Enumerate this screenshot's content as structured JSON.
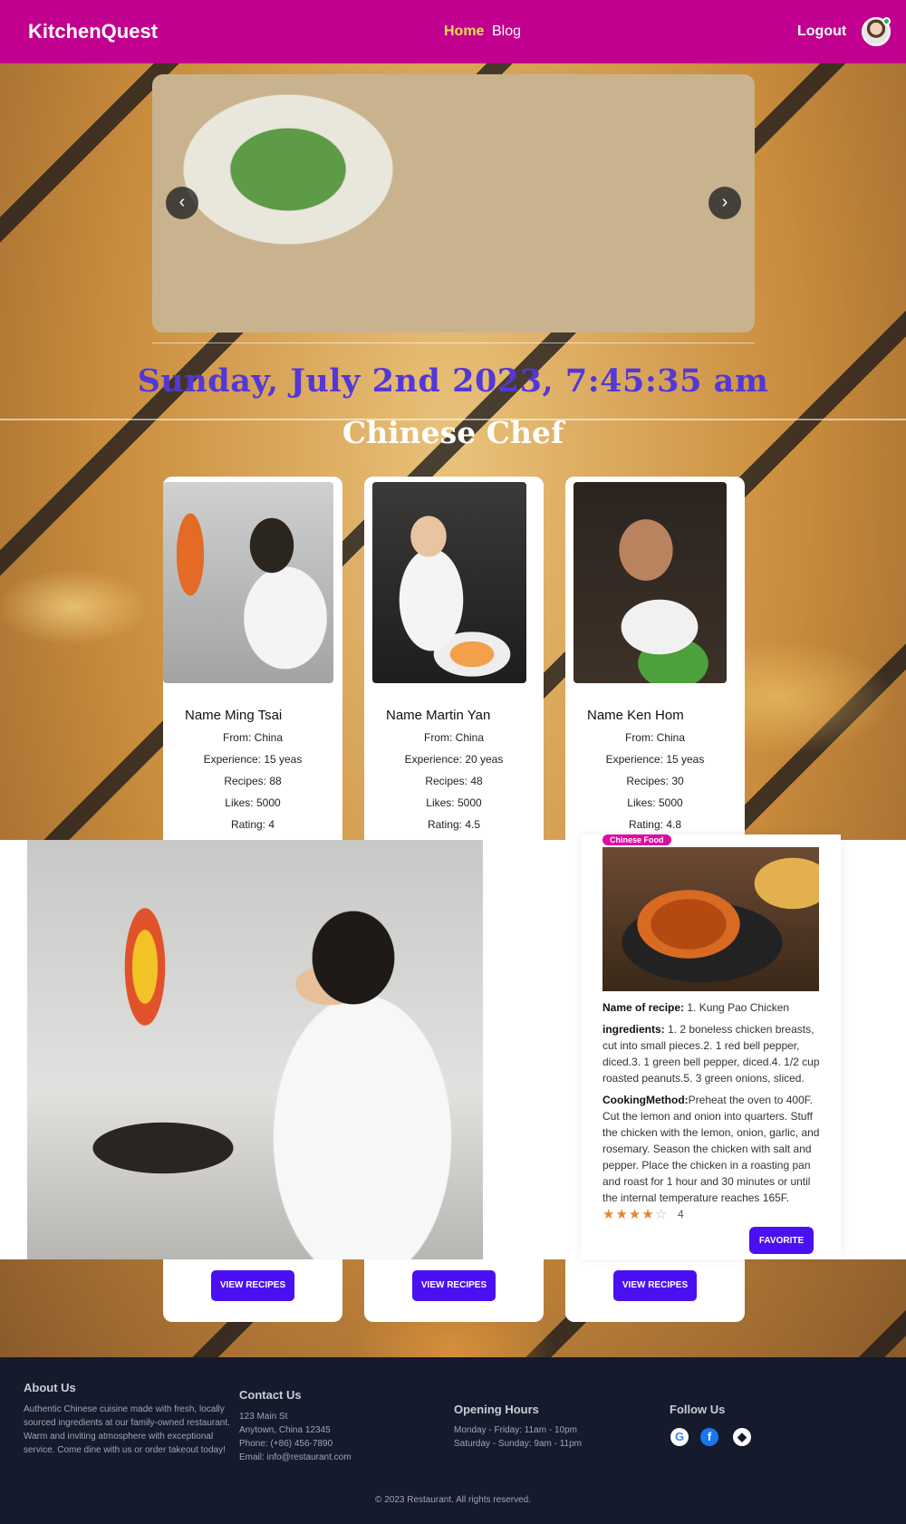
{
  "nav": {
    "brand": "KitchenQuest",
    "links": [
      "Home",
      "Blog"
    ],
    "logout": "Logout"
  },
  "carousel": {
    "prev_icon": "‹",
    "next_icon": "›"
  },
  "clock": "Sunday, July 2nd 2023, 7:45:35 am",
  "section_title": "Chinese Chef",
  "chefs": [
    {
      "name": "Name Ming Tsai",
      "from": "From: China",
      "experience": "Experience: 15 yeas",
      "recipes": "Recipes: 88",
      "likes": "Likes: 5000",
      "rating": "Rating: 4",
      "button": "VIEW RECIPES"
    },
    {
      "name": "Name Martin Yan",
      "from": "From: China",
      "experience": "Experience: 20 yeas",
      "recipes": "Recipes: 48",
      "likes": "Likes: 5000",
      "rating": "Rating: 4.5",
      "button": "VIEW RECIPES"
    },
    {
      "name": "Name Ken Hom",
      "from": "From: China",
      "experience": "Experience: 15 yeas",
      "recipes": "Recipes: 30",
      "likes": "Likes: 5000",
      "rating": "Rating: 4.8",
      "button": "VIEW RECIPES"
    }
  ],
  "recipe": {
    "badge": "Chinese Food",
    "name_label": "Name of recipe:",
    "name": " 1. Kung Pao Chicken",
    "ingredients_label": "ingredients:",
    "ingredients": " 1. 2 boneless chicken breasts, cut into small pieces.2. 1 red bell pepper, diced.3. 1 green bell pepper, diced.4. 1/2 cup roasted peanuts.5. 3 green onions, sliced.",
    "method_label": "CookingMethod:",
    "method": "Preheat the oven to 400F. Cut the lemon and onion into quarters. Stuff the chicken with the lemon, onion, garlic, and rosemary. Season the chicken with salt and pepper. Place the chicken in a roasting pan and roast for 1 hour and 30 minutes or until the internal temperature reaches 165F.",
    "stars_filled": "★★★★",
    "stars_empty": "☆",
    "rating": "4",
    "favorite": "FAVORITE"
  },
  "footer": {
    "about_title": "About Us",
    "about_text": "Authentic Chinese cuisine made with fresh, locally sourced ingredients at our family-owned restaurant. Warm and inviting atmosphere with exceptional service. Come dine with us or order takeout today!",
    "contact_title": "Contact Us",
    "contact_lines": [
      "123 Main St",
      "Anytown, China 12345",
      "Phone: (+86) 456-7890",
      "Email: info@restaurant.com"
    ],
    "hours_title": "Opening Hours",
    "hours_lines": [
      "Monday - Friday: 11am - 10pm",
      "Saturday - Sunday: 9am - 11pm"
    ],
    "follow_title": "Follow Us",
    "social_icons": [
      "google-icon",
      "facebook-icon",
      "github-icon"
    ],
    "copyright": "© 2023 Restaurant. All rights reserved."
  },
  "colors": {
    "nav_bg": "#c2008f",
    "accent_button": "#4b10f2",
    "clock": "#5338d6",
    "footer_bg": "#151a2c",
    "active_link": "#e9dc52"
  }
}
